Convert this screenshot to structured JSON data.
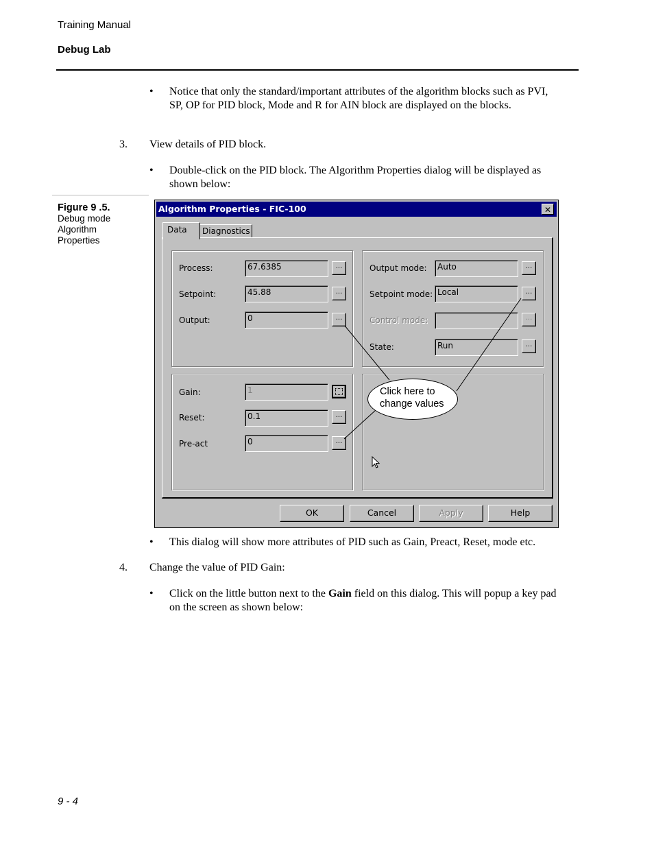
{
  "header": {
    "manual_title": "Training Manual",
    "section_title": "Debug Lab"
  },
  "body": {
    "bullet_notice": "Notice that only the standard/important attributes of the algorithm blocks such as PVI, SP, OP for PID block, Mode and R for AIN block are displayed on the blocks.",
    "step3_number": "3.",
    "step3_text": "View details of PID block.",
    "bullet_doubleclick": "Double-click on the PID block. The Algorithm Properties dialog will be displayed as shown below:",
    "bullet_more_attrs": "This dialog will show more attributes of PID such as Gain, Preact, Reset, mode etc.",
    "step4_number": "4.",
    "step4_text": "Change the value of PID Gain:",
    "bullet_click_pre": "Click on the little button next to the ",
    "bullet_click_bold": "Gain",
    "bullet_click_post": " field on this dialog. This will popup a key pad on the screen as shown below:",
    "bullet_glyph": "•"
  },
  "figure": {
    "number": "Figure 9 .5.",
    "caption": "Debug mode Algorithm Properties"
  },
  "dialog": {
    "title": "Algorithm Properties - FIC-100",
    "close_glyph": "✕",
    "tabs": [
      {
        "label": "Data",
        "active": true
      },
      {
        "label": "Diagnostics",
        "active": false
      }
    ],
    "left_top_fields": [
      {
        "label": "Process:",
        "value": "67.6385"
      },
      {
        "label": "Setpoint:",
        "value": "45.88"
      },
      {
        "label": "Output:",
        "value": "0"
      }
    ],
    "right_top_fields": [
      {
        "label": "Output mode:",
        "value": "Auto",
        "enabled": true
      },
      {
        "label": "Setpoint mode:",
        "value": "Local",
        "enabled": true
      },
      {
        "label": "Control mode:",
        "value": "",
        "enabled": false
      },
      {
        "label": "State:",
        "value": "Run",
        "enabled": true
      }
    ],
    "left_bottom_fields": [
      {
        "label": "Gain:",
        "value": "1",
        "focused": true
      },
      {
        "label": "Reset:",
        "value": "0.1"
      },
      {
        "label": "Pre-act",
        "value": "0"
      }
    ],
    "ellipsis": "...",
    "callout_line1": "Click here to",
    "callout_line2": "change values",
    "buttons": {
      "ok": "OK",
      "cancel": "Cancel",
      "apply": "Apply",
      "help": "Help"
    },
    "colors": {
      "titlebar": "#000080",
      "face": "#c0c0c0"
    }
  },
  "footer": {
    "page_number": "9 - 4"
  }
}
